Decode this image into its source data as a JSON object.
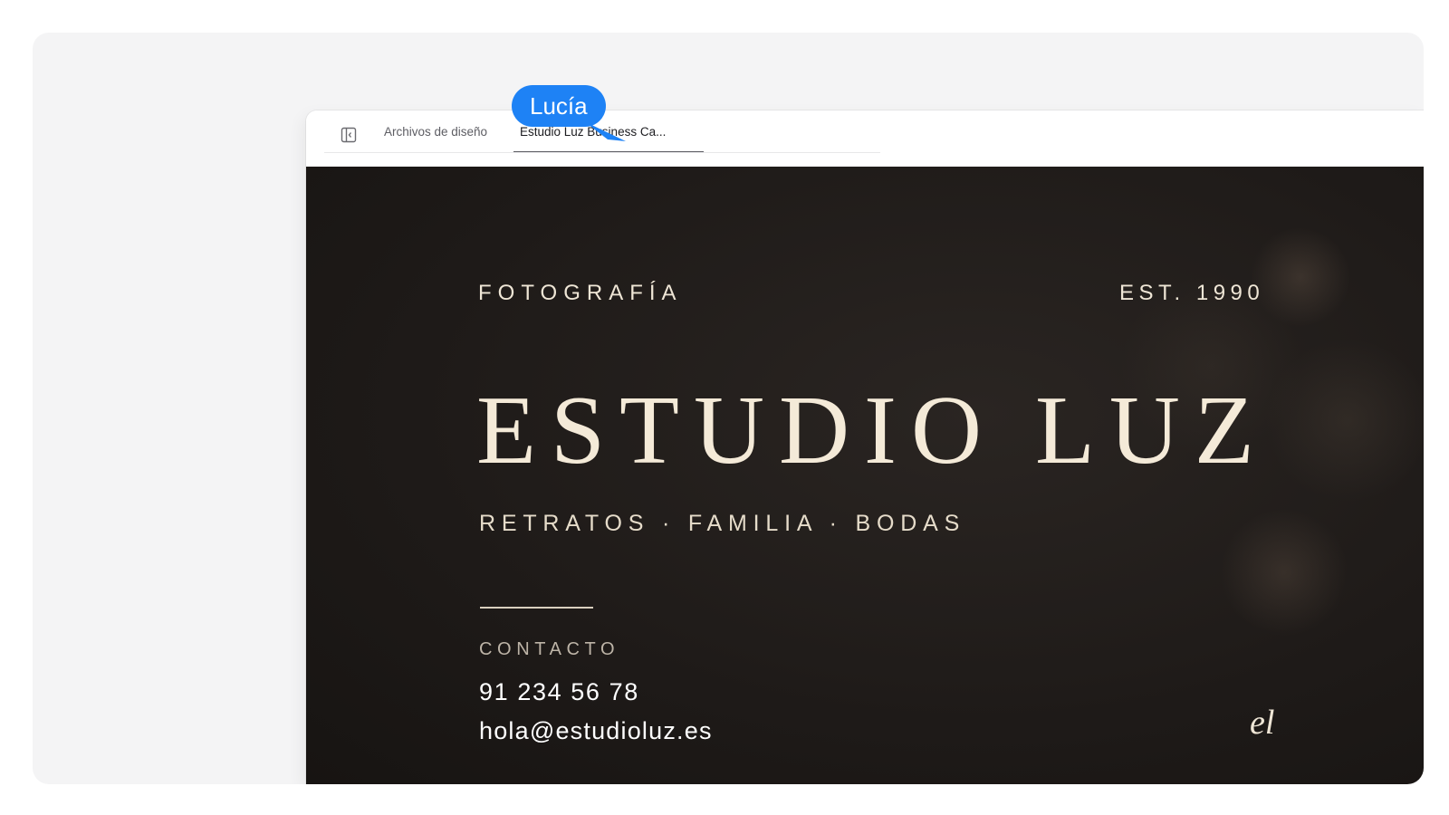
{
  "tabs": {
    "files_label": "Archivos de diseño",
    "active_label": "Estudio Luz Business Ca..."
  },
  "collaborator": {
    "name": "Lucía",
    "color": "#1e82f5"
  },
  "card": {
    "category": "FOTOGRAFÍA",
    "established": "EST. 1990",
    "studio_name": "ESTUDIO LUZ",
    "services": "RETRATOS · FAMILIA · BODAS",
    "contact_heading": "CONTACTO",
    "phone": "91 234 56 78",
    "email": "hola@estudioluz.es",
    "monogram": "el",
    "background_color": "#1e1a18",
    "text_color": "#f4ead8"
  },
  "icons": {
    "sidebar_toggle": "sidebar-toggle-icon",
    "cursor": "cursor-arrow-icon"
  }
}
